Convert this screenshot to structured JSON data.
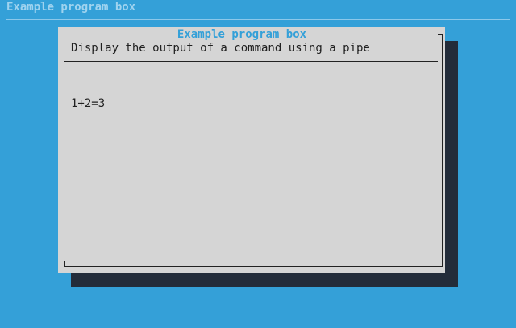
{
  "backtitle": "Example program box",
  "dialog": {
    "title": "Example program box",
    "prompt": "Display the output of a command using a pipe",
    "output_lines": [
      "1+2=3"
    ]
  }
}
